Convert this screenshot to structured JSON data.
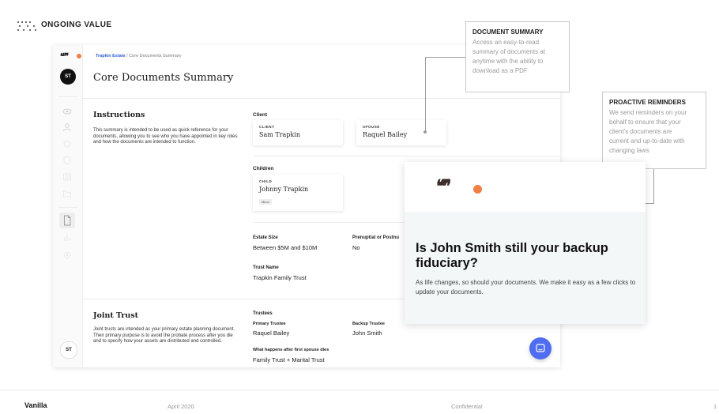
{
  "slide": {
    "section_label": "ONGOING VALUE",
    "footer": {
      "brand": "Vanilla",
      "date": "April 2020",
      "confidential": "Confidential",
      "page": "1"
    }
  },
  "app": {
    "logo_mark": "❛❛❜❜",
    "user_initials": "ST",
    "breadcrumb": {
      "estate": "Trapkin Estate",
      "separator": "/",
      "current": "Core Documents Summary"
    },
    "page_title": "Core Documents Summary",
    "instructions": {
      "title": "Instructions",
      "body": "This summary is intended to be used as quick reference for your documents, allowing you to see who you have appointed in key roles and how the documents are intended to function."
    },
    "client": {
      "heading": "Client",
      "cards": [
        {
          "caption": "CLIENT",
          "name": "Sam Trapkin"
        },
        {
          "caption": "SPOUSE",
          "name": "Raquel Bailey"
        }
      ]
    },
    "children": {
      "heading": "Children",
      "cards": [
        {
          "caption": "CHILD",
          "name": "Johnny Trapkin",
          "badge": "Minor"
        }
      ]
    },
    "estate_size": {
      "label": "Estate Size",
      "value": "Between $5M and $10M"
    },
    "prenup": {
      "label": "Prenuptial or Postnu",
      "value": "No"
    },
    "trust_name": {
      "label": "Trust Name",
      "value": "Trapkin Family Trust"
    },
    "joint_trust": {
      "title": "Joint Trust",
      "body": "Joint trusts are intended as your primary estate planning document. Their primary purpose is to avoid the probate process after you die and to specify how your assets are distributed and controlled."
    },
    "trustees": {
      "heading": "Trustees",
      "primary": {
        "label": "Primary Trustee",
        "value": "Raquel Bailey"
      },
      "backup": {
        "label": "Backup Trustee",
        "value": "John Smith"
      },
      "after_death": {
        "label": "What happens after first spouse dies",
        "value": "Family Trust + Marital Trust"
      }
    },
    "icons": [
      "eye-icon",
      "user-icon",
      "circle-icon",
      "shield-icon",
      "list-icon",
      "folder-icon",
      "document-icon",
      "chart-icon",
      "settings-icon",
      "chat-icon"
    ]
  },
  "callouts": {
    "summary": {
      "title": "DOCUMENT SUMMARY",
      "lines": [
        "Access an easy-to-read",
        "summary of documents at",
        "anytime with the ability to",
        "download as a PDF"
      ]
    },
    "reminders": {
      "title": "PROACTIVE REMINDERS",
      "lines": [
        "We send reminders on your",
        "behalf to ensure that your",
        "client's documents are",
        "current and up-to-date with",
        "changing laws"
      ]
    }
  },
  "reminder_card": {
    "logo_mark": "❛❛❜❜",
    "headline": "Is John Smith still your backup fiduciary?",
    "body": "As life changes, so should your documents. We make it easy as a few clicks to update your documents."
  },
  "colors": {
    "accent": "#ef7f45",
    "link": "#2f5fd3",
    "chat": "#4f6df0"
  }
}
